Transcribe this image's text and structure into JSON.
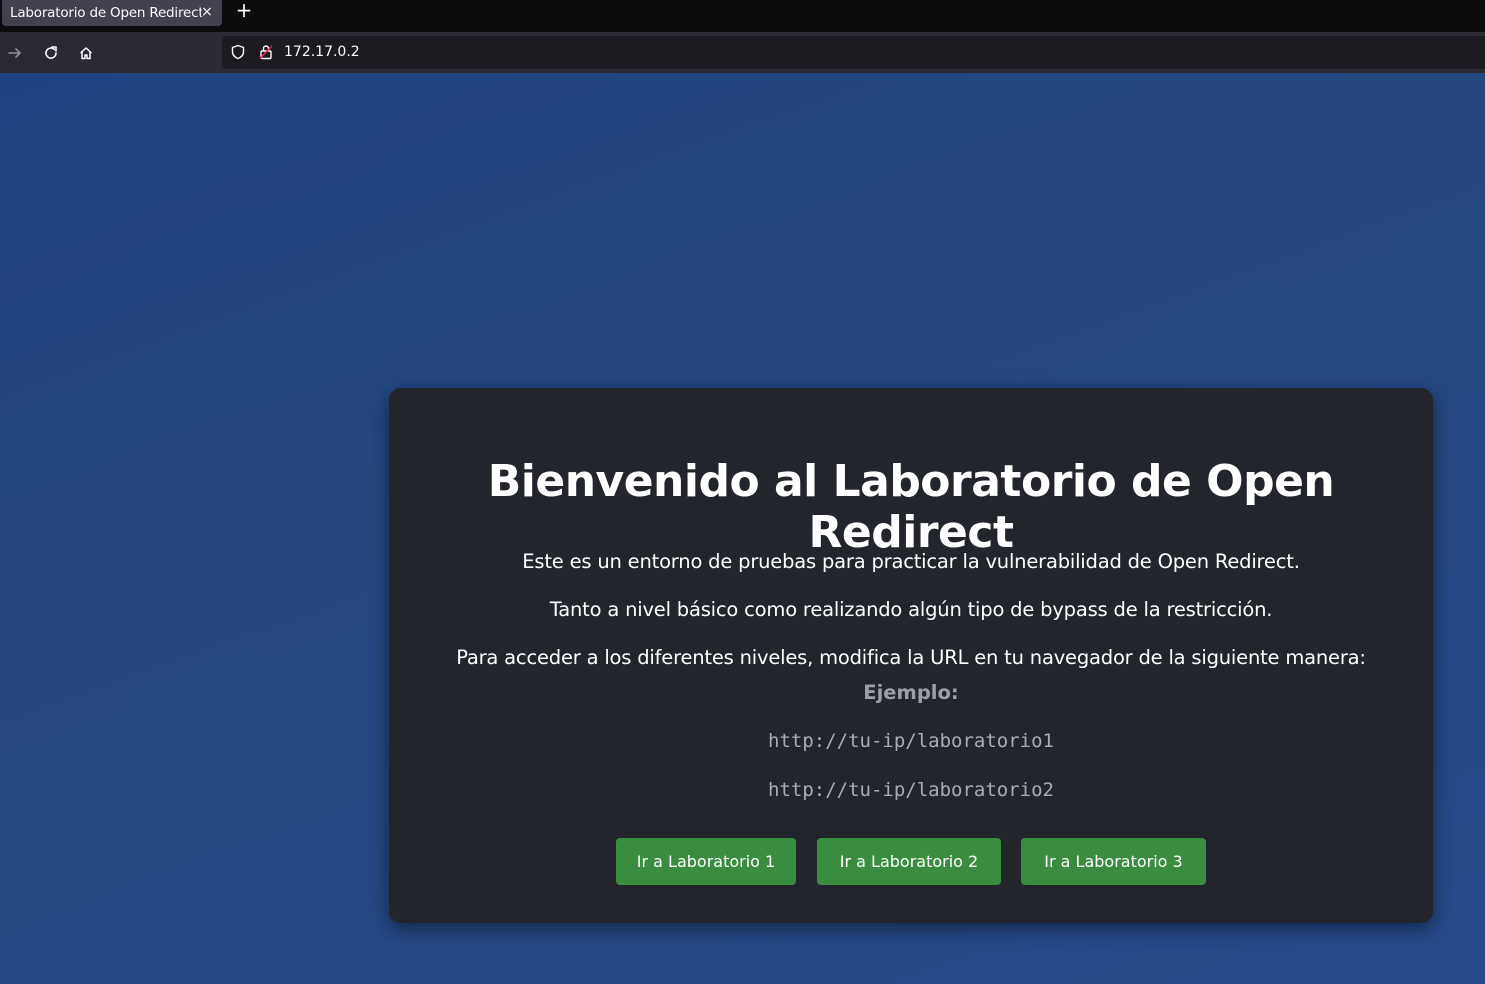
{
  "browser": {
    "tab_title": "Laboratorio de Open Redirect",
    "tab_close": "×",
    "new_tab": "+",
    "url": "172.17.0.2"
  },
  "page": {
    "heading": "Bienvenido al Laboratorio de Open Redirect",
    "paragraphs": [
      "Este es un entorno de pruebas para practicar la vulnerabilidad de Open Redirect.",
      "Tanto a nivel básico como realizando algún tipo de bypass de la restricción.",
      "Para acceder a los diferentes niveles, modifica la URL en tu navegador de la siguiente manera:"
    ],
    "example_label": "Ejemplo:",
    "examples": [
      "http://tu-ip/laboratorio1",
      "http://tu-ip/laboratorio2"
    ],
    "buttons": [
      "Ir a Laboratorio 1",
      "Ir a Laboratorio 2",
      "Ir a Laboratorio 3"
    ]
  },
  "colors": {
    "background": "#24477f",
    "card": "#22252c",
    "button": "#3a8d3f"
  }
}
